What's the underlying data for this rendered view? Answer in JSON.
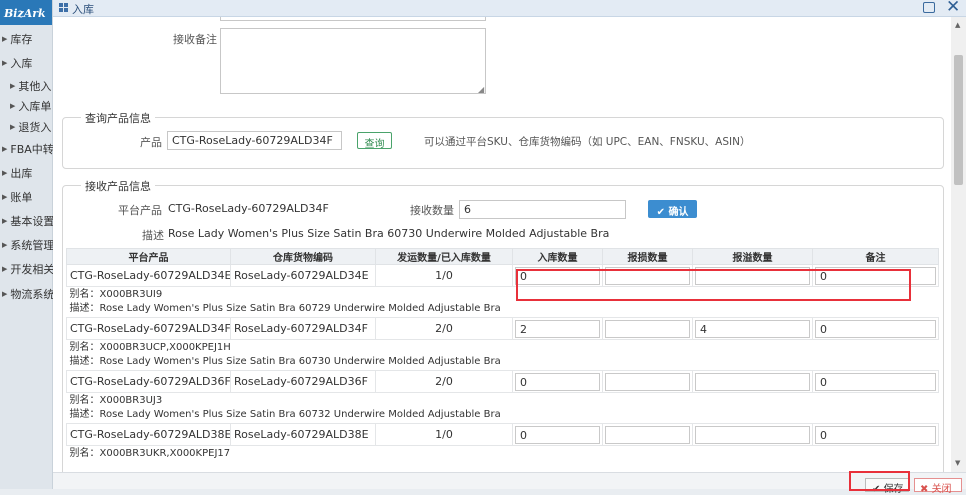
{
  "sidebar": {
    "logo": "BizArk",
    "items": [
      {
        "label": "库存",
        "level": 0
      },
      {
        "label": "入库",
        "level": 0
      },
      {
        "label": "其他入",
        "level": 1
      },
      {
        "label": "入库单",
        "level": 1
      },
      {
        "label": "退货入",
        "level": 1
      },
      {
        "label": "FBA中转",
        "level": 0
      },
      {
        "label": "出库",
        "level": 0
      },
      {
        "label": "账单",
        "level": 0
      },
      {
        "label": "基本设置",
        "level": 0
      },
      {
        "label": "系统管理",
        "level": 0
      },
      {
        "label": "开发相关",
        "level": 0
      },
      {
        "label": "物流系统",
        "level": 0
      }
    ]
  },
  "window": {
    "title": "入库"
  },
  "receive_note": {
    "label": "接收备注",
    "value": ""
  },
  "query_section": {
    "legend": "查询产品信息",
    "product_label": "产品",
    "product_value": "CTG-RoseLady-60729ALD34F",
    "query_button": "查询",
    "hint": "可以通过平台SKU、仓库货物编码（如 UPC、EAN、FNSKU、ASIN）"
  },
  "receive_section": {
    "legend": "接收产品信息",
    "platform_label": "平台产品",
    "platform_value": "CTG-RoseLady-60729ALD34F",
    "qty_label": "接收数量",
    "qty_value": "6",
    "confirm_button": "确认",
    "desc_label": "描述",
    "desc_value": "Rose Lady Women's Plus Size Satin Bra 60730 Underwire Molded Adjustable Bra"
  },
  "table": {
    "headers": [
      "平台产品",
      "仓库货物编码",
      "发运数量/已入库数量",
      "入库数量",
      "报损数量",
      "报溢数量",
      "备注"
    ],
    "rows": [
      {
        "platform": "CTG-RoseLady-60729ALD34E",
        "code": "RoseLady-60729ALD34E",
        "shipped": "1/0",
        "in_qty": "0",
        "damaged": "",
        "overflow": "",
        "note": "0",
        "alias": "别名：X000BR3UI9",
        "desc": "描述：Rose Lady Women's Plus Size Satin Bra 60729 Underwire Molded Adjustable Bra"
      },
      {
        "platform": "CTG-RoseLady-60729ALD34F",
        "code": "RoseLady-60729ALD34F",
        "shipped": "2/0",
        "in_qty": "2",
        "damaged": "",
        "overflow": "4",
        "note": "0",
        "alias": "别名：X000BR3UCP,X000KPEJ1H",
        "desc": "描述：Rose Lady Women's Plus Size Satin Bra 60730 Underwire Molded Adjustable Bra"
      },
      {
        "platform": "CTG-RoseLady-60729ALD36F",
        "code": "RoseLady-60729ALD36F",
        "shipped": "2/0",
        "in_qty": "0",
        "damaged": "",
        "overflow": "",
        "note": "0",
        "alias": "别名：X000BR3UJ3",
        "desc": "描述：Rose Lady Women's Plus Size Satin Bra 60732 Underwire Molded Adjustable Bra"
      },
      {
        "platform": "CTG-RoseLady-60729ALD38E",
        "code": "RoseLady-60729ALD38E",
        "shipped": "1/0",
        "in_qty": "0",
        "damaged": "",
        "overflow": "",
        "note": "0",
        "alias": "别名：X000BR3UKR,X000KPEJ17",
        "desc": ""
      }
    ]
  },
  "footer": {
    "save": "保存",
    "close": "关闭"
  },
  "colors": {
    "highlight": "#e8303a",
    "primary": "#3c8dd0",
    "query_green": "#2f8a4f"
  }
}
